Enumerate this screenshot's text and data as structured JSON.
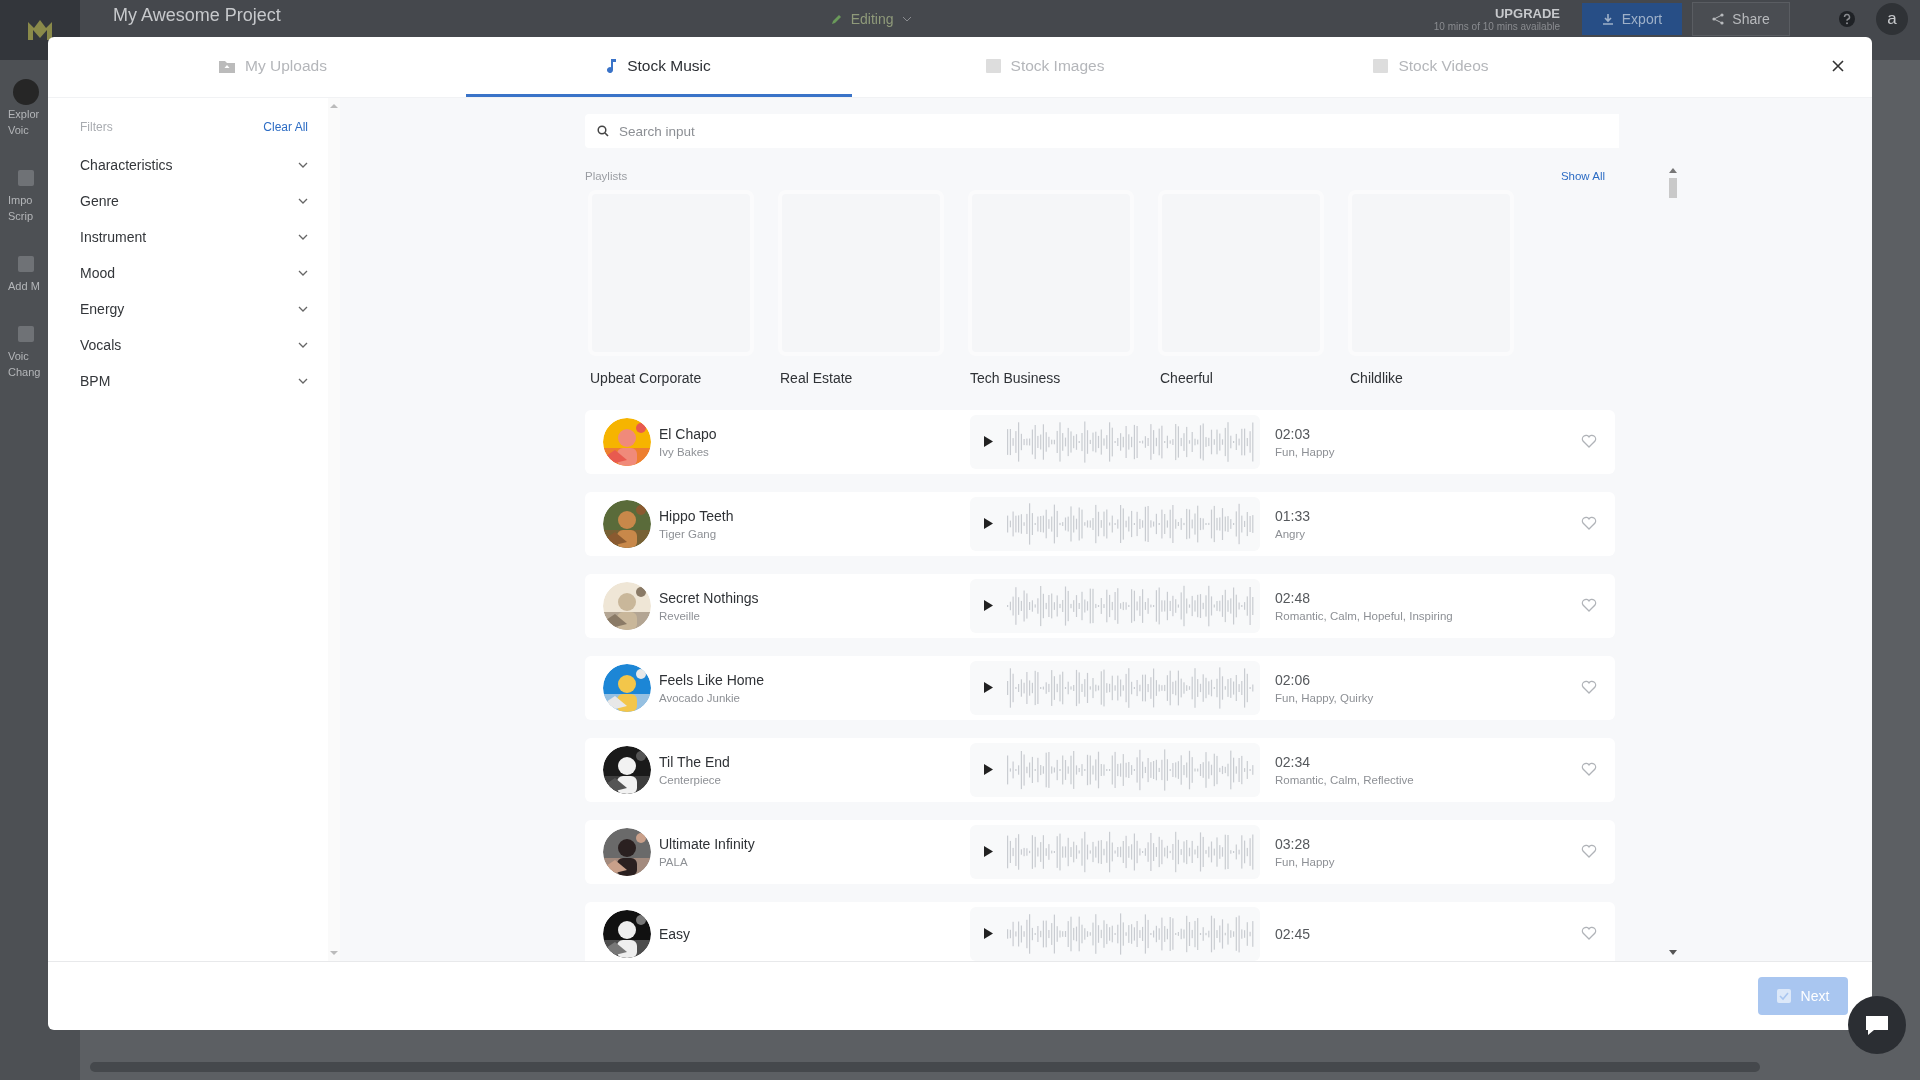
{
  "app": {
    "project_title": "My Awesome Project",
    "mode": "Editing",
    "upgrade": "UPGRADE",
    "usage": "10 mins of 10 mins available",
    "export": "Export",
    "share": "Share",
    "avatar": "a"
  },
  "app_sidebar": [
    {
      "lines": [
        "Explor",
        "Voic"
      ]
    },
    {
      "lines": [
        "Impo",
        "Scrip"
      ]
    },
    {
      "lines": [
        "Add M"
      ]
    },
    {
      "lines": [
        "Voic",
        "Chang"
      ]
    }
  ],
  "modal": {
    "tabs": [
      {
        "label": "My Uploads",
        "selected": false
      },
      {
        "label": "Stock Music",
        "selected": true
      },
      {
        "label": "Stock Images",
        "selected": false
      },
      {
        "label": "Stock Videos",
        "selected": false
      }
    ],
    "filters": {
      "title": "Filters",
      "clear": "Clear All",
      "items": [
        {
          "label": "Characteristics",
          "expanded": false
        },
        {
          "label": "Genre",
          "expanded": false
        },
        {
          "label": "Instrument",
          "expanded": false
        },
        {
          "label": "Mood",
          "expanded": false
        },
        {
          "label": "Energy",
          "expanded": false
        },
        {
          "label": "Vocals",
          "expanded": false
        },
        {
          "label": "BPM",
          "expanded": false
        }
      ]
    },
    "search": {
      "placeholder": "Search input"
    },
    "playlists": {
      "title": "Playlists",
      "show_all": "Show All",
      "items": [
        "Upbeat Corporate",
        "Real Estate",
        "Tech Business",
        "Cheerful",
        "Childlike"
      ]
    },
    "tracks": [
      {
        "title": "El Chapo",
        "artist": "Ivy Bakes",
        "duration": "02:03",
        "moods": "Fun, Happy",
        "favorite": false
      },
      {
        "title": "Hippo Teeth",
        "artist": "Tiger Gang",
        "duration": "01:33",
        "moods": "Angry",
        "favorite": false
      },
      {
        "title": "Secret Nothings",
        "artist": "Reveille",
        "duration": "02:48",
        "moods": "Romantic, Calm, Hopeful, Inspiring",
        "favorite": false
      },
      {
        "title": "Feels Like Home",
        "artist": "Avocado Junkie",
        "duration": "02:06",
        "moods": "Fun, Happy, Quirky",
        "favorite": false
      },
      {
        "title": "Til The End",
        "artist": "Centerpiece",
        "duration": "02:34",
        "moods": "Romantic, Calm, Reflective",
        "favorite": false
      },
      {
        "title": "Ultimate Infinity",
        "artist": "PALA",
        "duration": "03:28",
        "moods": "Fun, Happy",
        "favorite": false
      },
      {
        "title": "Easy",
        "duration": "02:45",
        "favorite": false
      }
    ],
    "next": {
      "label": "Next",
      "disabled": true
    }
  }
}
